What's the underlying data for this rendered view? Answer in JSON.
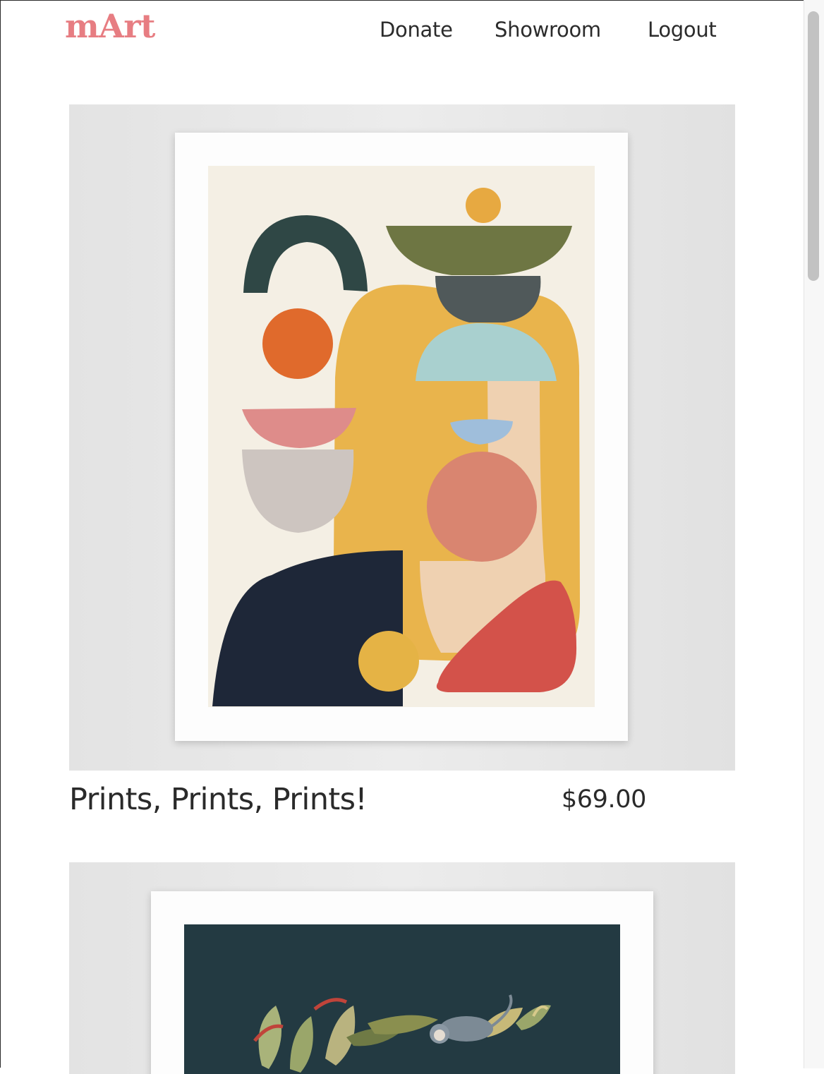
{
  "header": {
    "logo": "mArt",
    "nav": [
      {
        "label": "Donate"
      },
      {
        "label": "Showroom"
      },
      {
        "label": "Logout"
      }
    ]
  },
  "products": [
    {
      "title": "Prints, Prints, Prints!",
      "price": "$69.00",
      "artwork": "abstract-shapes-print"
    },
    {
      "title": "",
      "price": "",
      "artwork": "jungle-monkey-print"
    }
  ],
  "colors": {
    "brand": "#e77d82",
    "text": "#2a2a2a"
  }
}
